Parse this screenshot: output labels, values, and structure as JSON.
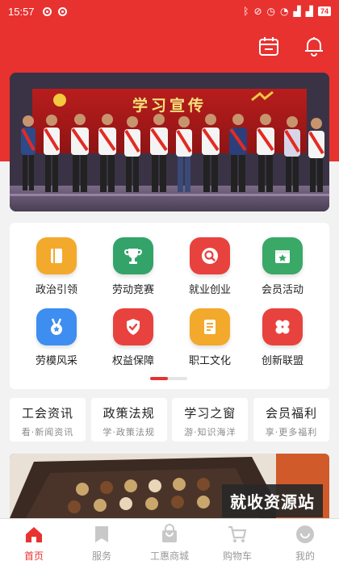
{
  "status_bar": {
    "time": "15:57",
    "battery": "74"
  },
  "header": {
    "icons": [
      "calendar-icon",
      "bell-icon"
    ],
    "accent_color": "#e8322f"
  },
  "banner": {
    "title": "学习宣传"
  },
  "features": {
    "items": [
      {
        "label": "政治引领",
        "icon": "book-icon",
        "color": "#f3a92b"
      },
      {
        "label": "劳动竞赛",
        "icon": "trophy-icon",
        "color": "#34a36a"
      },
      {
        "label": "就业创业",
        "icon": "search-icon",
        "color": "#e8423f"
      },
      {
        "label": "会员活动",
        "icon": "star-calendar-icon",
        "color": "#3aa866"
      },
      {
        "label": "劳模风采",
        "icon": "medal-icon",
        "color": "#3e8df0"
      },
      {
        "label": "权益保障",
        "icon": "shield-check-icon",
        "color": "#e8423f"
      },
      {
        "label": "职工文化",
        "icon": "document-icon",
        "color": "#f3a92b"
      },
      {
        "label": "创新联盟",
        "icon": "grid-flower-icon",
        "color": "#e8423f"
      }
    ]
  },
  "quick_links": [
    {
      "title": "工会资讯",
      "subtitle": "看·新闻资讯"
    },
    {
      "title": "政策法规",
      "subtitle": "学·政策法规"
    },
    {
      "title": "学习之窗",
      "subtitle": "游·知识海洋"
    },
    {
      "title": "会员福利",
      "subtitle": "享·更多福利"
    }
  ],
  "promo": {
    "watermark": "就收资源站"
  },
  "bottom_nav": [
    {
      "label": "首页",
      "icon": "home-icon",
      "active": true
    },
    {
      "label": "服务",
      "icon": "bookmark-icon",
      "active": false
    },
    {
      "label": "工惠商城",
      "icon": "shop-bag-icon",
      "active": false
    },
    {
      "label": "购物车",
      "icon": "cart-icon",
      "active": false
    },
    {
      "label": "我的",
      "icon": "profile-icon",
      "active": false
    }
  ]
}
